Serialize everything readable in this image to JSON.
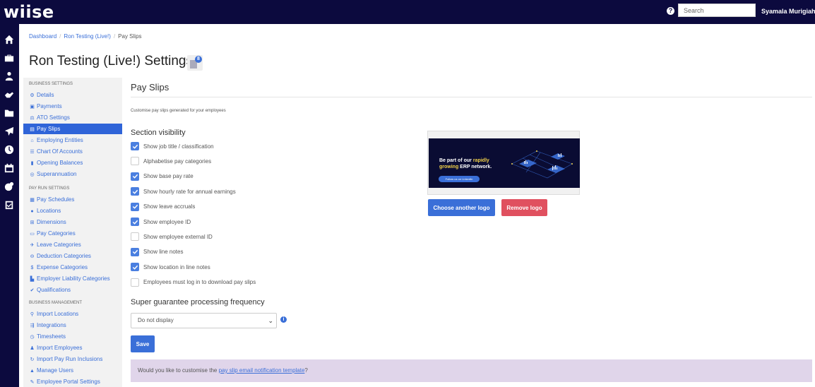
{
  "app": {
    "logo_text": "wiise",
    "search_placeholder": "Search",
    "user_name": "Syamala Murigiah"
  },
  "rail_icons": [
    "home-icon",
    "briefcase-icon",
    "people-icon",
    "handshake-icon",
    "folder-icon",
    "plane-icon",
    "clock-icon",
    "calendar-icon",
    "piggy-bank-icon",
    "clipboard-check-icon"
  ],
  "breadcrumb": {
    "items": [
      "Dashboard",
      "Ron Testing (Live!)"
    ],
    "current": "Pay Slips"
  },
  "page": {
    "title": "Ron Testing (Live!) Settings",
    "title_badge": "8"
  },
  "menu": {
    "business_settings": {
      "heading": "BUSINESS SETTINGS",
      "items": [
        {
          "label": "Details",
          "icon": "gear-icon",
          "glyph": "⚙"
        },
        {
          "label": "Payments",
          "icon": "save-icon",
          "glyph": "▣"
        },
        {
          "label": "ATO Settings",
          "icon": "scale-icon",
          "glyph": "⚖"
        },
        {
          "label": "Pay Slips",
          "icon": "pay-slip-icon",
          "glyph": "▤",
          "active": true
        },
        {
          "label": "Employing Entities",
          "icon": "institution-icon",
          "glyph": "⌂"
        },
        {
          "label": "Chart Of Accounts",
          "icon": "list-icon",
          "glyph": "☰"
        },
        {
          "label": "Opening Balances",
          "icon": "book-icon",
          "glyph": "▮"
        },
        {
          "label": "Superannuation",
          "icon": "lifebuoy-icon",
          "glyph": "◎"
        }
      ]
    },
    "pay_run_settings": {
      "heading": "PAY RUN SETTINGS",
      "items": [
        {
          "label": "Pay Schedules",
          "icon": "calendar-icon",
          "glyph": "▦"
        },
        {
          "label": "Locations",
          "icon": "location-icon",
          "glyph": "●"
        },
        {
          "label": "Dimensions",
          "icon": "dimensions-icon",
          "glyph": "⊞"
        },
        {
          "label": "Pay Categories",
          "icon": "money-icon",
          "glyph": "▭"
        },
        {
          "label": "Leave Categories",
          "icon": "plane-icon",
          "glyph": "✈"
        },
        {
          "label": "Deduction Categories",
          "icon": "minus-circle-icon",
          "glyph": "⊖"
        },
        {
          "label": "Expense Categories",
          "icon": "dollar-circle-icon",
          "glyph": "$"
        },
        {
          "label": "Employer Liability Categories",
          "icon": "industry-icon",
          "glyph": "▙"
        },
        {
          "label": "Qualifications",
          "icon": "check-icon",
          "glyph": "✔"
        }
      ]
    },
    "business_management": {
      "heading": "BUSINESS MANAGEMENT",
      "items": [
        {
          "label": "Import Locations",
          "icon": "map-pin-icon",
          "glyph": "⚲"
        },
        {
          "label": "Integrations",
          "icon": "integration-icon",
          "glyph": "⇶"
        },
        {
          "label": "Timesheets",
          "icon": "clock-icon",
          "glyph": "◷"
        },
        {
          "label": "Import Employees",
          "icon": "users-icon",
          "glyph": "♟"
        },
        {
          "label": "Import Pay Run Inclusions",
          "icon": "refresh-icon",
          "glyph": "↻"
        },
        {
          "label": "Manage Users",
          "icon": "lock-icon",
          "glyph": "▲"
        },
        {
          "label": "Employee Portal Settings",
          "icon": "pencil-icon",
          "glyph": "✎"
        }
      ]
    }
  },
  "content": {
    "section_title": "Pay Slips",
    "subtitle": "Customise pay slips generated for your employees",
    "visibility_heading": "Section visibility",
    "checkboxes": [
      {
        "label": "Show job title / classification",
        "checked": true
      },
      {
        "label": "Alphabetise pay categories",
        "checked": false
      },
      {
        "label": "Show base pay rate",
        "checked": true
      },
      {
        "label": "Show hourly rate for annual earnings",
        "checked": true
      },
      {
        "label": "Show leave accruals",
        "checked": true
      },
      {
        "label": "Show employee ID",
        "checked": true
      },
      {
        "label": "Show employee external ID",
        "checked": false
      },
      {
        "label": "Show line notes",
        "checked": true
      },
      {
        "label": "Show location in line notes",
        "checked": true
      },
      {
        "label": "Employees must log in to download pay slips",
        "checked": false
      }
    ],
    "frequency_heading": "Super guarantee processing frequency",
    "frequency_value": "Do not display",
    "save_label": "Save",
    "notice_prefix": "Would you like to customise the ",
    "notice_link": "pay slip email notification template",
    "notice_suffix": "?"
  },
  "logo_panel": {
    "banner_line1_prefix": "Be part of our ",
    "banner_line1_highlight": "rapidly",
    "banner_line2_highlight": "growing",
    "banner_line2_suffix": " ERP network.",
    "banner_button": "Follow us on LinkedIn",
    "choose_label": "Choose another logo",
    "remove_label": "Remove logo"
  },
  "colors": {
    "navy": "#0c0a3e",
    "accent": "#3a6fd8",
    "active_menu": "#2f64d8",
    "danger": "#e0505f",
    "notice_bg": "#e0d5ea"
  }
}
